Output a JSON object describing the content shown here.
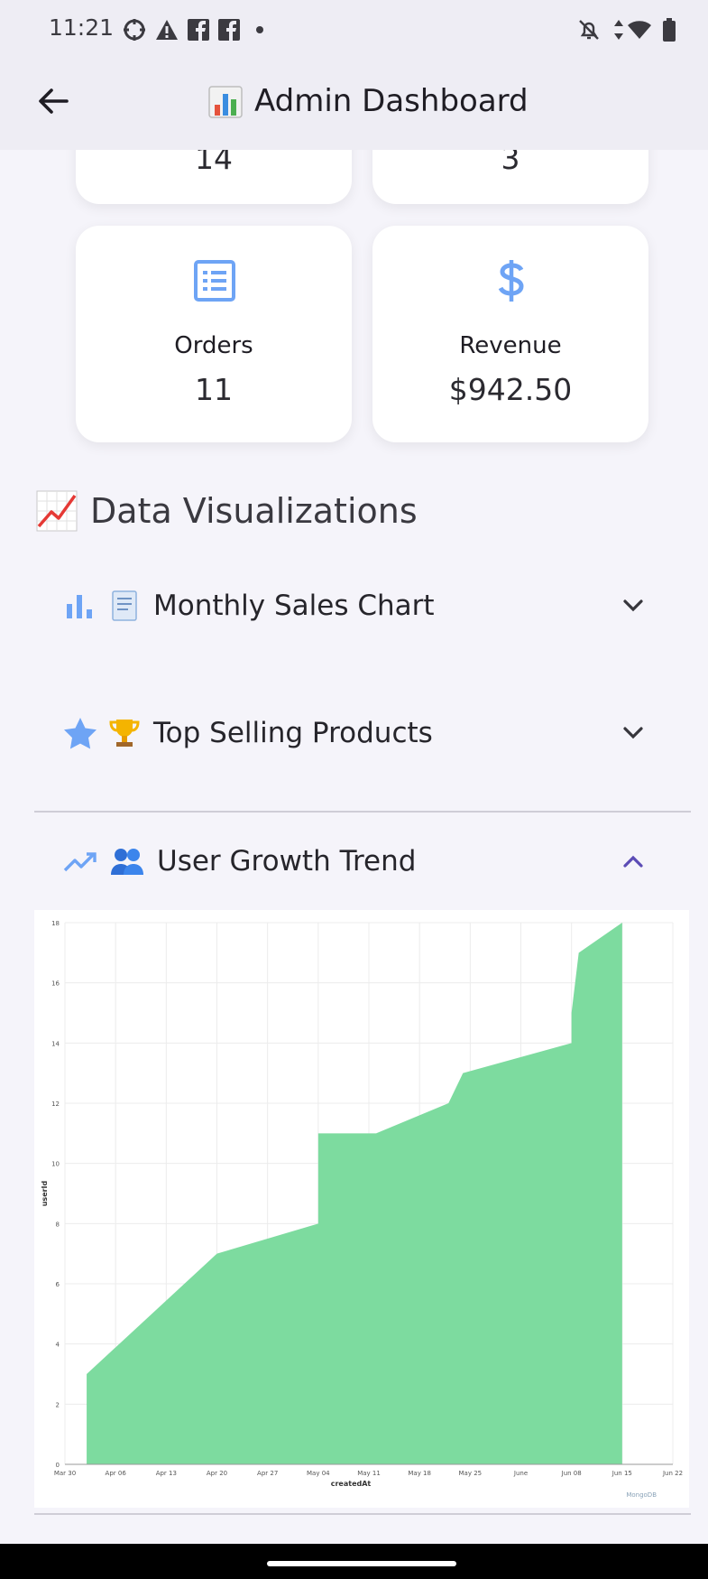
{
  "status_bar": {
    "time": "11:21",
    "icons": [
      "settings-gear-icon",
      "warning-icon",
      "facebook-icon",
      "facebook-icon",
      "dot-icon",
      "notifications-off-icon",
      "data-arrows-icon",
      "wifi-icon",
      "battery-icon"
    ]
  },
  "app_bar": {
    "back_icon": "arrow-left-icon",
    "title_icon": "bar-chart-emoji",
    "title": "Admin Dashboard"
  },
  "stats": {
    "top_left_value": "14",
    "top_right_value": "3",
    "orders_label": "Orders",
    "orders_value": "11",
    "revenue_label": "Revenue",
    "revenue_value": "$942.50",
    "orders_icon": "list-icon",
    "revenue_icon": "dollar-icon"
  },
  "visualizations": {
    "title": "Data Visualizations",
    "title_icon": "chart-increasing-emoji",
    "sections": [
      {
        "icon": "bar-chart-icon",
        "emoji": "receipt-emoji",
        "label": "Monthly Sales Chart",
        "expanded": false
      },
      {
        "icon": "star-icon",
        "emoji": "trophy-emoji",
        "label": "Top Selling Products",
        "expanded": false
      },
      {
        "icon": "trending-up-icon",
        "emoji": "people-emoji",
        "label": "User Growth Trend",
        "expanded": true
      }
    ]
  },
  "chart_data": {
    "type": "area",
    "xlabel": "createdAt",
    "ylabel": "userId",
    "x_ticks": [
      "Mar 30",
      "Apr 06",
      "Apr 13",
      "Apr 20",
      "Apr 27",
      "May 04",
      "May 11",
      "May 18",
      "May 25",
      "June",
      "Jun 08",
      "Jun 15",
      "Jun 22"
    ],
    "y_ticks": [
      "0",
      "2",
      "4",
      "6",
      "8",
      "10",
      "12",
      "14",
      "16",
      "18"
    ],
    "ylim": [
      0,
      18
    ],
    "x": [
      "Apr 02",
      "Apr 02",
      "Apr 20",
      "May 04",
      "May 04",
      "May 12",
      "May 22",
      "May 24",
      "Jun 08",
      "Jun 08",
      "Jun 09",
      "Jun 15"
    ],
    "y": [
      2,
      3,
      7,
      8,
      11,
      11,
      12,
      13,
      14,
      15,
      17,
      18
    ],
    "color": "#7ddb9f",
    "watermark": "MongoDB"
  },
  "colors": {
    "accent_blue": "#6ea4f5",
    "chart_fill": "#7ddb9f",
    "chevron_active": "#5b4bb5"
  }
}
